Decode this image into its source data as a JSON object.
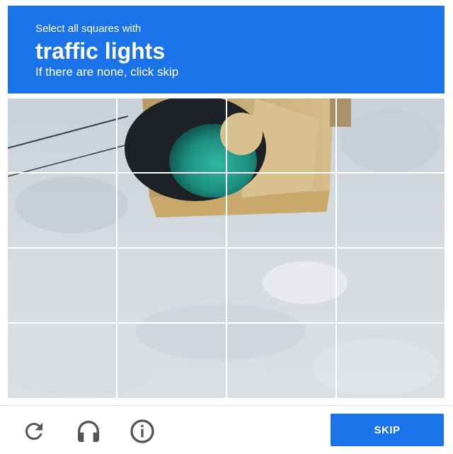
{
  "header": {
    "instruction": "Select all squares with",
    "target": "traffic lights",
    "hint": "If there are none, click skip"
  },
  "grid": {
    "rows": 4,
    "columns": 4
  },
  "footer": {
    "reload_icon": "reload-icon",
    "audio_icon": "headphones-icon",
    "info_icon": "info-icon",
    "skip_label": "SKIP"
  },
  "colors": {
    "accent": "#1a73e8"
  }
}
